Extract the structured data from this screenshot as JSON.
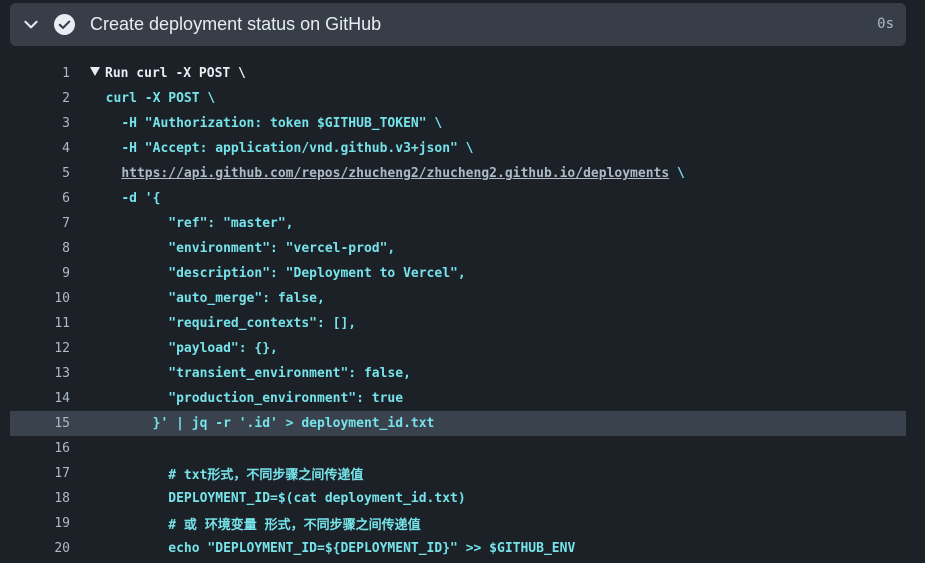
{
  "step": {
    "title": "Create deployment status on GitHub",
    "duration": "0s",
    "status_icon": "check-circle-icon",
    "toggle_icon": "chevron-down-icon"
  },
  "colors": {
    "header_bg": "#373e47",
    "page_bg": "#1c2128",
    "code_cyan": "#76e3ea",
    "highlight_bg": "#3a424d"
  },
  "log": {
    "lines": [
      {
        "num": "1",
        "indent": "",
        "pre": "Run curl -X POST \\",
        "link": "",
        "post": "",
        "cyan": false
      },
      {
        "num": "2",
        "indent": "  ",
        "pre": "curl -X POST \\",
        "link": "",
        "post": "",
        "cyan": true
      },
      {
        "num": "3",
        "indent": "    ",
        "pre": "-H \"Authorization: token $GITHUB_TOKEN\" \\",
        "link": "",
        "post": "",
        "cyan": true
      },
      {
        "num": "4",
        "indent": "    ",
        "pre": "-H \"Accept: application/vnd.github.v3+json\" \\",
        "link": "",
        "post": "",
        "cyan": true
      },
      {
        "num": "5",
        "indent": "    ",
        "pre": "",
        "link": "https://api.github.com/repos/zhucheng2/zhucheng2.github.io/deployments",
        "post": " \\",
        "cyan": true
      },
      {
        "num": "6",
        "indent": "    ",
        "pre": "-d '{",
        "link": "",
        "post": "",
        "cyan": true
      },
      {
        "num": "7",
        "indent": "          ",
        "pre": "\"ref\": \"master\",",
        "link": "",
        "post": "",
        "cyan": true
      },
      {
        "num": "8",
        "indent": "          ",
        "pre": "\"environment\": \"vercel-prod\",",
        "link": "",
        "post": "",
        "cyan": true
      },
      {
        "num": "9",
        "indent": "          ",
        "pre": "\"description\": \"Deployment to Vercel\",",
        "link": "",
        "post": "",
        "cyan": true
      },
      {
        "num": "10",
        "indent": "          ",
        "pre": "\"auto_merge\": false,",
        "link": "",
        "post": "",
        "cyan": true
      },
      {
        "num": "11",
        "indent": "          ",
        "pre": "\"required_contexts\": [],",
        "link": "",
        "post": "",
        "cyan": true
      },
      {
        "num": "12",
        "indent": "          ",
        "pre": "\"payload\": {},",
        "link": "",
        "post": "",
        "cyan": true
      },
      {
        "num": "13",
        "indent": "          ",
        "pre": "\"transient_environment\": false,",
        "link": "",
        "post": "",
        "cyan": true
      },
      {
        "num": "14",
        "indent": "          ",
        "pre": "\"production_environment\": true",
        "link": "",
        "post": "",
        "cyan": true
      },
      {
        "num": "15",
        "indent": "        ",
        "pre": "}' | jq -r '.id' > deployment_id.txt",
        "link": "",
        "post": "",
        "cyan": true
      },
      {
        "num": "16",
        "indent": "",
        "pre": "",
        "link": "",
        "post": "",
        "cyan": true
      },
      {
        "num": "17",
        "indent": "          ",
        "pre": "# txt形式，不同步骤之间传递值",
        "link": "",
        "post": "",
        "cyan": true
      },
      {
        "num": "18",
        "indent": "          ",
        "pre": "DEPLOYMENT_ID=$(cat deployment_id.txt)",
        "link": "",
        "post": "",
        "cyan": true
      },
      {
        "num": "19",
        "indent": "          ",
        "pre": "# 或 环境变量 形式，不同步骤之间传递值",
        "link": "",
        "post": "",
        "cyan": true
      },
      {
        "num": "20",
        "indent": "          ",
        "pre": "echo \"DEPLOYMENT_ID=${DEPLOYMENT_ID}\" >> $GITHUB_ENV",
        "link": "",
        "post": "",
        "cyan": true
      }
    ],
    "highlighted_line": "15"
  }
}
